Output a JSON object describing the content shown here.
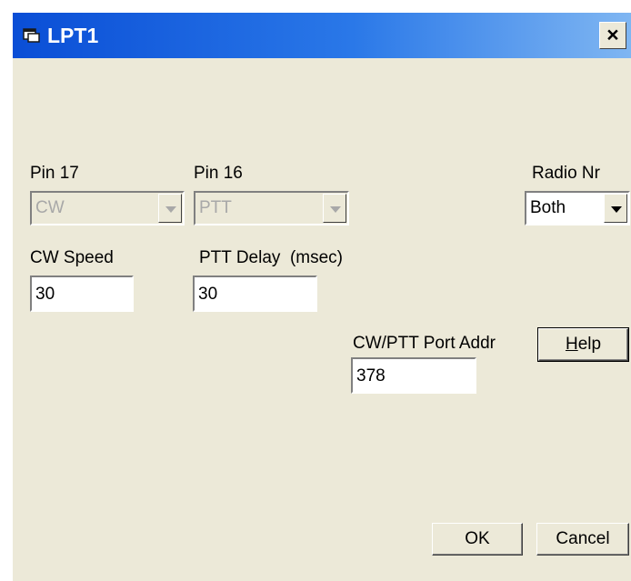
{
  "window": {
    "title": "LPT1",
    "close_glyph": "×",
    "icon": "window-icon"
  },
  "pin17": {
    "label": "Pin 17",
    "value": "CW",
    "enabled": false
  },
  "pin16": {
    "label": "Pin 16",
    "value": "PTT",
    "enabled": false
  },
  "radio_nr": {
    "label": "Radio Nr",
    "value": "Both"
  },
  "cw_speed": {
    "label": "CW Speed",
    "value": "30"
  },
  "ptt_delay": {
    "label": "PTT Delay  (msec)",
    "value": "30"
  },
  "port_addr": {
    "label": "CW/PTT Port Addr",
    "value": "378"
  },
  "buttons": {
    "help_mnemonic": "H",
    "help_rest": "elp",
    "ok": "OK",
    "cancel": "Cancel"
  },
  "colors": {
    "titlebar_start": "#0a4ed6",
    "titlebar_end": "#7fb6f2",
    "dialog_bg": "#ece9d8",
    "disabled_text": "#a8a8a8"
  }
}
